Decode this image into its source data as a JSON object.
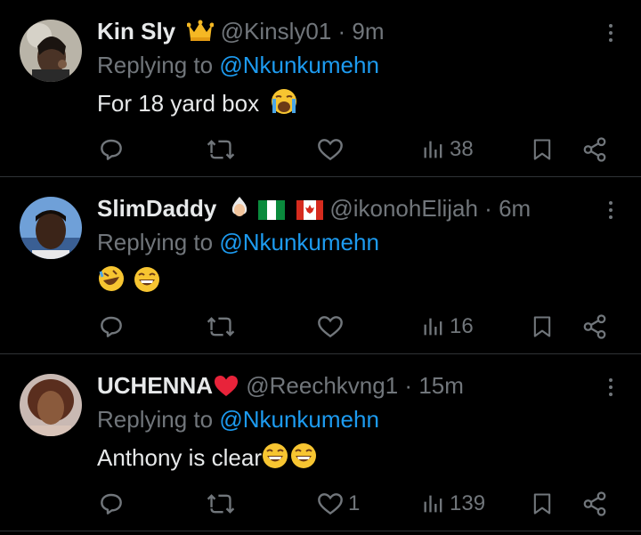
{
  "tweets": [
    {
      "name": "Kin Sly",
      "handle": "@Kinsly01",
      "sep": "·",
      "time": "9m",
      "replying_prefix": "Replying to",
      "replying_to": "@Nkunkumehn",
      "text": "For 18 yard box",
      "likes": "",
      "views": "38",
      "emojis": [
        "crown",
        "crying-face"
      ]
    },
    {
      "name": "SlimDaddy",
      "handle": "@ikonohElijah",
      "sep": "·",
      "time": "6m",
      "replying_prefix": "Replying to",
      "replying_to": "@Nkunkumehn",
      "text": "",
      "likes": "",
      "views": "16",
      "emojis": [
        "person-bald",
        "flag-nigeria",
        "flag-canada",
        "rofl-face",
        "grinning-face"
      ]
    },
    {
      "name": "UCHENNA",
      "handle": "@Reechkvng1",
      "sep": "·",
      "time": "15m",
      "replying_prefix": "Replying to",
      "replying_to": "@Nkunkumehn",
      "text": "Anthony is clear",
      "likes": "1",
      "views": "139",
      "emojis": [
        "red-heart",
        "grinning-face",
        "grinning-face"
      ]
    }
  ],
  "colors": {
    "background": "#000000",
    "text": "#e7e9ea",
    "muted": "#71767b",
    "link": "#1d9bf0",
    "divider": "#2f3336"
  }
}
